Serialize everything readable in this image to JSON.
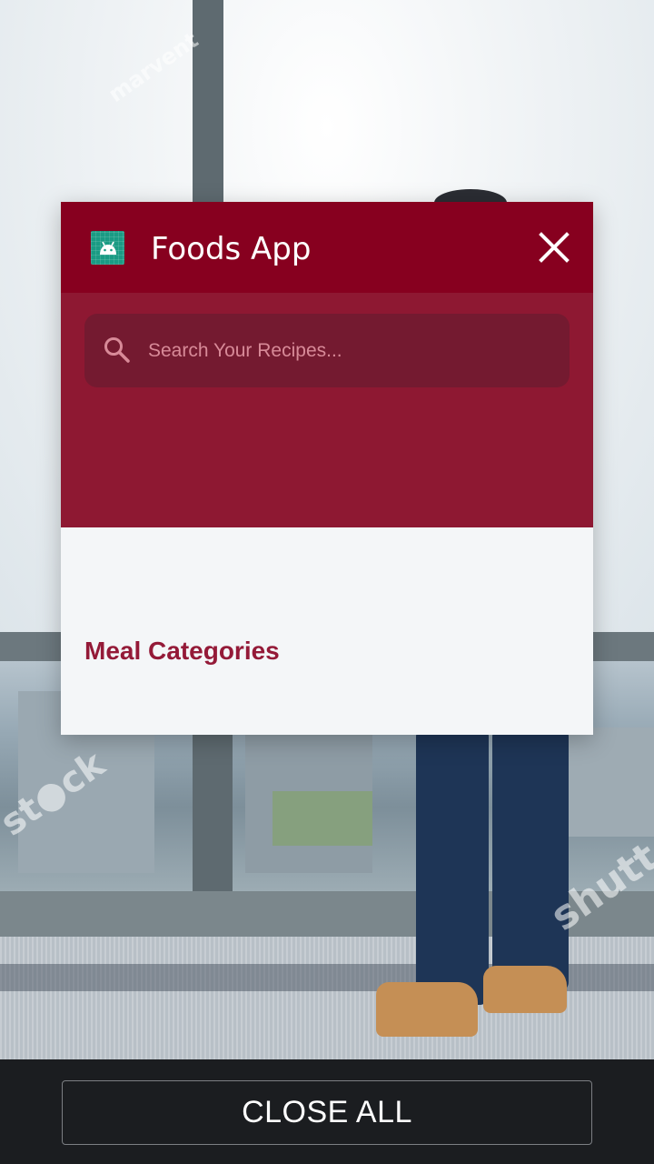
{
  "recents": {
    "app": {
      "title": "Foods App",
      "icon": "android-app-icon",
      "close_icon": "close-icon"
    },
    "screen": {
      "search": {
        "placeholder": "Search Your Recipes...",
        "value": "",
        "icon": "search-icon"
      },
      "section_title": "Meal Categories"
    }
  },
  "bottom_bar": {
    "close_all_label": "CLOSE ALL"
  },
  "colors": {
    "header": "#87001f",
    "hero": "#8e1832",
    "search_bg": "#741a30",
    "accent_text": "#941a38",
    "app_icon": "#1a9b84"
  }
}
